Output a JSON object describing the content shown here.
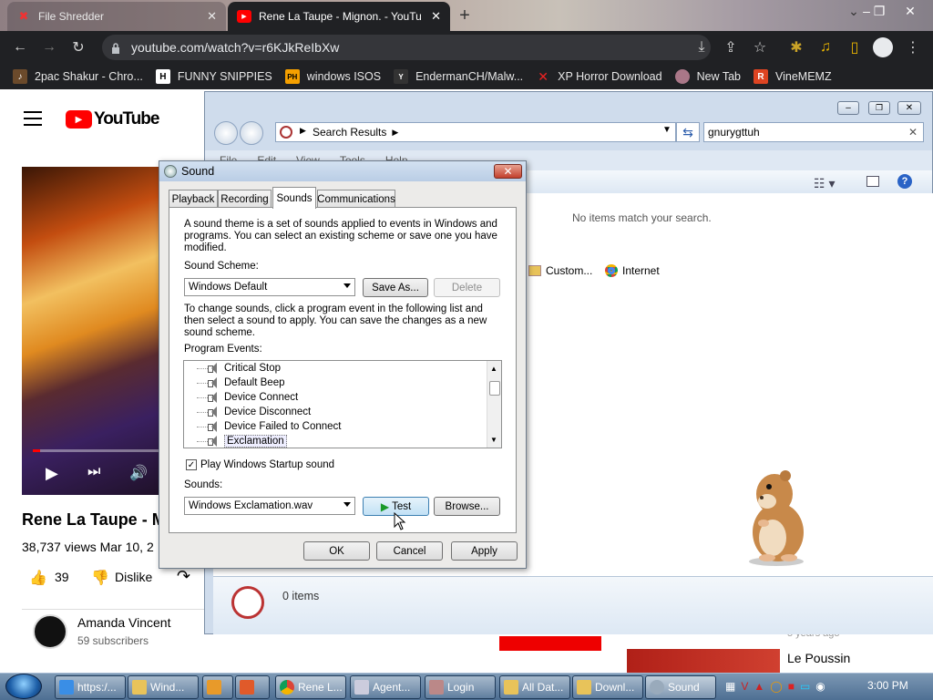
{
  "browser": {
    "tabs": [
      {
        "title": "File Shredder",
        "icon": "file-shredder-icon",
        "active": false
      },
      {
        "title": "Rene La Taupe - Mignon. - YouTu",
        "icon": "youtube-icon",
        "active": true
      }
    ],
    "new_tab": "+",
    "url": "youtube.com/watch?v=r6KJkReIbXw",
    "bookmarks": [
      {
        "label": "2pac Shakur - Chro..."
      },
      {
        "label": "FUNNY SNIPPIES"
      },
      {
        "label": "windows ISOS"
      },
      {
        "label": "EndermanCH/Malw..."
      },
      {
        "label": "XP Horror Download"
      },
      {
        "label": "New Tab"
      },
      {
        "label": "VineMEMZ"
      }
    ]
  },
  "youtube": {
    "logo": "YouTube",
    "video_title": "Rene La Taupe - M",
    "views": "38,737 views  Mar 10, 2",
    "likes": "39",
    "dislike": "Dislike",
    "channel": "Amanda Vincent",
    "subscribers": "59 subscribers",
    "side_item": "Le Poussin",
    "side_time": "5 years ago"
  },
  "explorer": {
    "breadcrumb": "Search Results",
    "search_value": "gnurygttuh",
    "menu": [
      "File",
      "Edit",
      "View",
      "Tools",
      "Help"
    ],
    "no_items": "No items match your search.",
    "search_again": [
      "Custom...",
      "Internet"
    ],
    "item_count": "0 items"
  },
  "sound_dialog": {
    "title": "Sound",
    "tabs": [
      "Playback",
      "Recording",
      "Sounds",
      "Communications"
    ],
    "active_tab": "Sounds",
    "intro": "A sound theme is a set of sounds applied to events in Windows and programs.  You can select an existing scheme or save one you have modified.",
    "scheme_label": "Sound Scheme:",
    "scheme_value": "Windows Default",
    "save_as": "Save As...",
    "delete": "Delete",
    "change_text": "To change sounds, click a program event in the following list and then select a sound to apply.  You can save the changes as a new sound scheme.",
    "events_label": "Program Events:",
    "events": [
      "Critical Stop",
      "Default Beep",
      "Device Connect",
      "Device Disconnect",
      "Device Failed to Connect",
      "Exclamation"
    ],
    "selected_event": "Exclamation",
    "startup_label": "Play Windows Startup sound",
    "startup_checked": true,
    "sounds_label": "Sounds:",
    "sound_value": "Windows Exclamation.wav",
    "test": "Test",
    "browse": "Browse...",
    "ok": "OK",
    "cancel": "Cancel",
    "apply": "Apply"
  },
  "taskbar": {
    "items": [
      "https:/...",
      "Wind...",
      "",
      "",
      "Rene L...",
      "Agent...",
      "Login",
      "All Dat...",
      "Downl...",
      "Sound"
    ],
    "clock": "3:00 PM"
  },
  "colors": {
    "chrome_dark": "#202124",
    "youtube_red": "#ff0000",
    "dialog_bg": "#ecebe9",
    "taskbar": "#4e6f93"
  }
}
